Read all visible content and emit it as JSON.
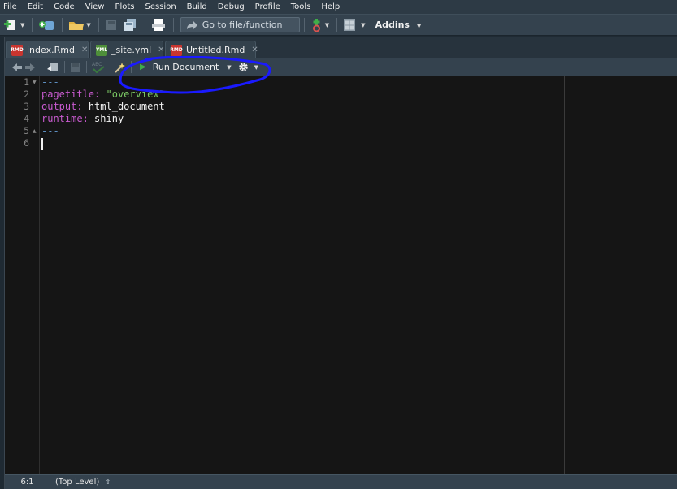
{
  "menu": [
    "File",
    "Edit",
    "Code",
    "View",
    "Plots",
    "Session",
    "Build",
    "Debug",
    "Profile",
    "Tools",
    "Help"
  ],
  "toolbar": {
    "goto_placeholder": "Go to file/function",
    "addins_label": "Addins"
  },
  "tabs": [
    {
      "label": "index.Rmd",
      "icon": "rmd-file-icon",
      "active": true
    },
    {
      "label": "_site.yml",
      "icon": "yml-file-icon",
      "active": false
    },
    {
      "label": "Untitled.Rmd",
      "icon": "rmd-file-icon",
      "active": false
    }
  ],
  "editor_toolbar": {
    "run_label": "Run Document",
    "spell_label": "ABC"
  },
  "code": {
    "line_numbers": [
      "1",
      "2",
      "3",
      "4",
      "5",
      "6"
    ],
    "l1": "---",
    "l2_key": "pagetitle",
    "l2_colon": ":",
    "l2_val": "\"overview\"",
    "l3_key": "output",
    "l3_colon": ":",
    "l3_val": "html_document",
    "l4_key": "runtime",
    "l4_colon": ":",
    "l4_val": "shiny",
    "l5": "---"
  },
  "status": {
    "position": "6:1",
    "scope": "(Top Level)"
  },
  "colors": {
    "annotation": "#1a1aff",
    "run_icon": "#3fae49"
  }
}
